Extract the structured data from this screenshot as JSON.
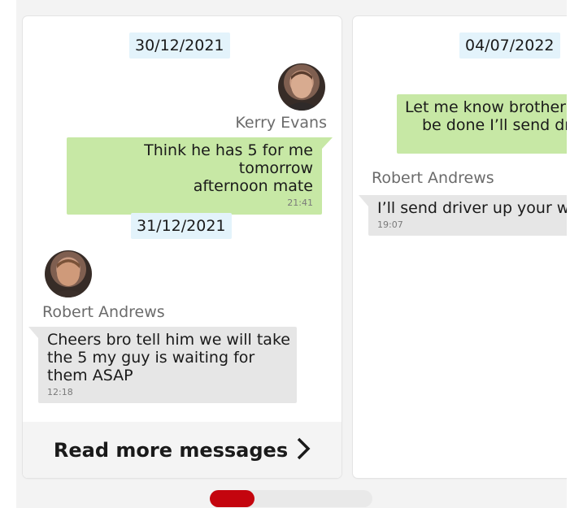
{
  "cards": [
    {
      "messages": [
        {
          "date": "30/12/2021",
          "sender": "Kerry Evans",
          "direction": "outgoing",
          "text_lines": [
            "Think he has 5 for me tomorrow",
            "afternoon mate"
          ],
          "time": "21:41"
        },
        {
          "date": "31/12/2021",
          "sender": "Robert Andrews",
          "direction": "incoming",
          "text_lines": [
            "Cheers bro tell him we will take",
            "the 5 my guy is waiting for",
            "them ASAP"
          ],
          "time": "12:18"
        }
      ],
      "read_more_label": "Read more messages",
      "read_more_icon": "chevron-right-icon"
    },
    {
      "messages": [
        {
          "date": "04/07/2022",
          "direction": "outgoing",
          "text_lines": [
            "Let me know brother",
            "be done I’ll send dr"
          ]
        },
        {
          "sender": "Robert Andrews",
          "direction": "incoming",
          "text_lines": [
            "I’ll send driver up your wa"
          ],
          "time": "19:07"
        }
      ]
    }
  ],
  "carousel": {
    "pages": 2,
    "active_page": 1
  },
  "colors": {
    "outgoing_bubble": "#c7e8a5",
    "incoming_bubble": "#e6e6e6",
    "date_chip": "#e3f3fb",
    "pager_active": "#c4050e",
    "pager_track": "#e9e9e9"
  }
}
